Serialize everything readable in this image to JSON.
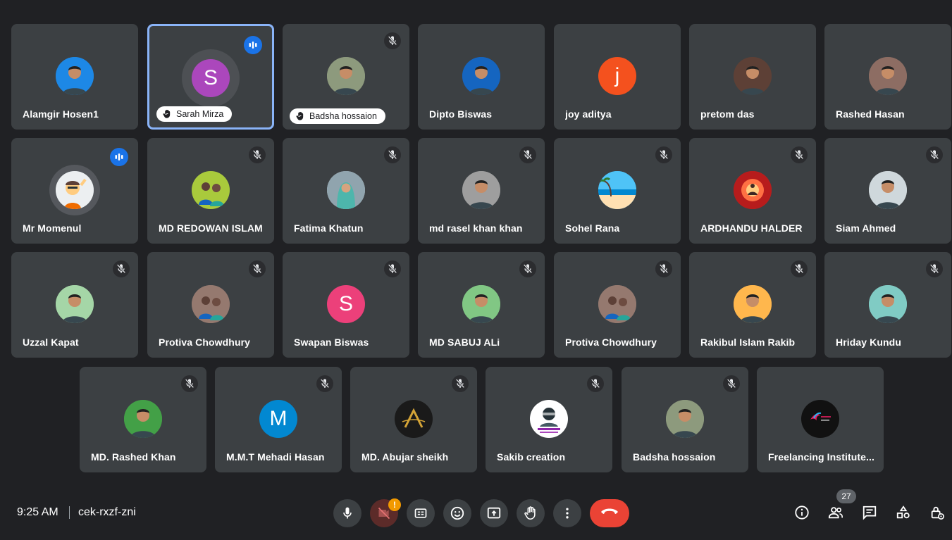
{
  "participants": [
    {
      "name": "Alamgir Hosen1",
      "avatar_color": "#1e88e5",
      "avatar_icon": "man-photo"
    },
    {
      "name": "Sarah Mirza",
      "avatar_letter": "S",
      "avatar_color": "#ab47bc",
      "hand_raised": true,
      "speaking": true
    },
    {
      "name": "Badsha hossaion",
      "avatar_color": "#8d9a7e",
      "avatar_icon": "man-photo",
      "hand_raised": true,
      "muted": true
    },
    {
      "name": "Dipto Biswas",
      "avatar_color": "#1565c0",
      "avatar_icon": "man-photo"
    },
    {
      "name": "joy aditya",
      "avatar_letter": "j",
      "avatar_color": "#f4511e"
    },
    {
      "name": "pretom das",
      "avatar_color": "#5d4037",
      "avatar_icon": "man-photo"
    },
    {
      "name": "Rashed Hasan",
      "avatar_color": "#8d6e63",
      "avatar_icon": "man-photo"
    },
    {
      "name": "Mr Momenul",
      "avatar_color": "#90a4ae",
      "avatar_icon": "cartoon-photo",
      "speaking": true
    },
    {
      "name": "MD REDOWAN ISLAM",
      "avatar_color": "#7cb342",
      "avatar_icon": "group-photo",
      "muted": true
    },
    {
      "name": "Fatima Khatun",
      "avatar_color": "#b0bec5",
      "avatar_icon": "woman-photo",
      "muted": true
    },
    {
      "name": "md rasel khan khan",
      "avatar_color": "#9e9e9e",
      "avatar_icon": "man-photo",
      "muted": true
    },
    {
      "name": "Sohel Rana",
      "avatar_color": "#29b6f6",
      "avatar_icon": "beach-photo",
      "muted": true
    },
    {
      "name": "ARDHANDU HALDER",
      "avatar_color": "#c62828",
      "avatar_icon": "meditation-photo",
      "muted": true
    },
    {
      "name": "Siam Ahmed",
      "avatar_color": "#cfd8dc",
      "avatar_icon": "man-photo",
      "muted": true
    },
    {
      "name": "Uzzal Kapat",
      "avatar_color": "#a5d6a7",
      "avatar_icon": "man-photo",
      "muted": true
    },
    {
      "name": "Protiva Chowdhury",
      "avatar_color": "#a1887f",
      "avatar_icon": "child-photo",
      "muted": true
    },
    {
      "name": "Swapan Biswas",
      "avatar_letter": "S",
      "avatar_color": "#ec407a",
      "muted": true
    },
    {
      "name": "MD SABUJ ALi",
      "avatar_color": "#81c784",
      "avatar_icon": "man-photo",
      "muted": true
    },
    {
      "name": "Protiva Chowdhury",
      "avatar_color": "#a1887f",
      "avatar_icon": "child-photo",
      "muted": true
    },
    {
      "name": "Rakibul Islam Rakib",
      "avatar_color": "#ffb74d",
      "avatar_icon": "man-photo",
      "muted": true
    },
    {
      "name": "Hriday Kundu",
      "avatar_color": "#80cbc4",
      "avatar_icon": "man-photo",
      "muted": true
    },
    {
      "name": "MD. Rashed Khan",
      "avatar_color": "#43a047",
      "avatar_icon": "man-photo",
      "muted": true
    },
    {
      "name": "M.M.T Mehadi Hasan",
      "avatar_letter": "M",
      "avatar_color": "#0288d1",
      "muted": true
    },
    {
      "name": "MD. Abujar sheikh",
      "avatar_color": "#1a1a1a",
      "avatar_icon": "logo-A",
      "muted": true
    },
    {
      "name": "Sakib creation",
      "avatar_color": "#ffffff",
      "avatar_icon": "logo-creation",
      "muted": true
    },
    {
      "name": "Badsha hossaion",
      "avatar_color": "#8d9a7e",
      "avatar_icon": "man-photo",
      "muted": true
    },
    {
      "name": "Freelancing Institute...",
      "avatar_color": "#111111",
      "avatar_icon": "logo-bird"
    }
  ],
  "meeting": {
    "time": "9:25 AM",
    "code": "cek-rxzf-zni",
    "participant_count": "27",
    "camera_alert": "!"
  },
  "controls": {
    "mic": "mic-icon",
    "camera": "camera-off-icon",
    "captions": "captions-icon",
    "reactions": "emoji-icon",
    "present": "present-screen-icon",
    "raise_hand": "raise-hand-icon",
    "more": "more-options-icon",
    "leave": "end-call-icon",
    "info": "info-icon",
    "people": "people-icon",
    "chat": "chat-icon",
    "activities": "activities-icon",
    "host_controls": "host-controls-icon"
  }
}
